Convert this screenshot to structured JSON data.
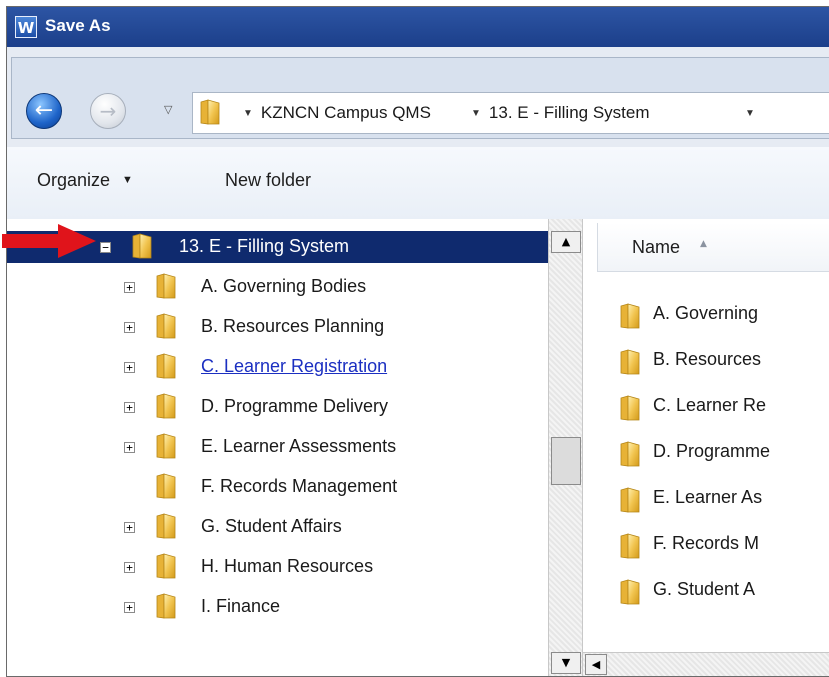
{
  "window": {
    "title": "Save As",
    "app_icon_letter": "W"
  },
  "address": {
    "back_icon": "back-arrow-icon",
    "forward_icon": "forward-arrow-icon",
    "breadcrumbs": [
      "KZNCN Campus QMS",
      "13. E - Filling System"
    ]
  },
  "toolbar": {
    "organize_label": "Organize",
    "new_folder_label": "New folder"
  },
  "tree": {
    "root": {
      "label": "13. E - Filling System",
      "expander": "−",
      "selected": true
    },
    "items": [
      {
        "label": "A. Governing Bodies",
        "expander": "+"
      },
      {
        "label": "B. Resources Planning",
        "expander": "+"
      },
      {
        "label": "C. Learner Registration",
        "expander": "+",
        "hovered": true
      },
      {
        "label": "D. Programme Delivery",
        "expander": "+"
      },
      {
        "label": "E. Learner Assessments",
        "expander": "+"
      },
      {
        "label": "F. Records Management",
        "expander": ""
      },
      {
        "label": "G. Student Affairs",
        "expander": "+"
      },
      {
        "label": "H. Human Resources",
        "expander": "+"
      },
      {
        "label": "I. Finance",
        "expander": "+"
      }
    ]
  },
  "files": {
    "column_name": "Name",
    "items": [
      "A. Governing",
      "B. Resources",
      "C. Learner Re",
      "D. Programme",
      "E. Learner As",
      "F. Records M",
      "G. Student A"
    ]
  },
  "colors": {
    "selection": "#0f2a6e",
    "title_bar": "#2d55a4",
    "link": "#1b2fc1",
    "annotation_arrow": "#e0141b"
  }
}
